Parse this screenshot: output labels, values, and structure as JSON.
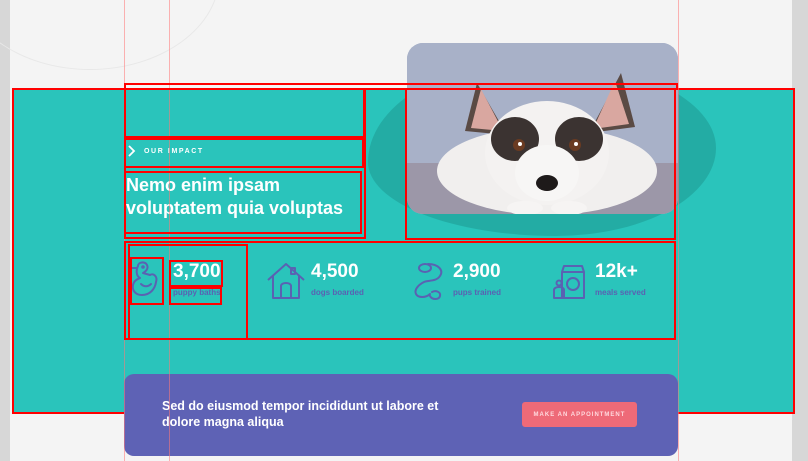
{
  "section": {
    "eyebrow": "OUR IMPACT",
    "headline_line1": "Nemo enim ipsam",
    "headline_line2": "voluptatem quia voluptas"
  },
  "stats": [
    {
      "icon": "duck-icon",
      "value": "3,700",
      "label": "puppy baths"
    },
    {
      "icon": "dog-house-icon",
      "value": "4,500",
      "label": "dogs boarded"
    },
    {
      "icon": "leash-icon",
      "value": "2,900",
      "label": "pups trained"
    },
    {
      "icon": "dog-food-icon",
      "value": "12k+",
      "label": "meals served"
    }
  ],
  "banner": {
    "message": "Sed do eiusmod tempor incididunt ut labore et dolore magna aliqua",
    "cta_label": "MAKE AN APPOINTMENT"
  },
  "colors": {
    "teal": "#2ac4bb",
    "purple": "#5e62b5",
    "coral": "#ee6a78",
    "outline": "#ff0000"
  }
}
